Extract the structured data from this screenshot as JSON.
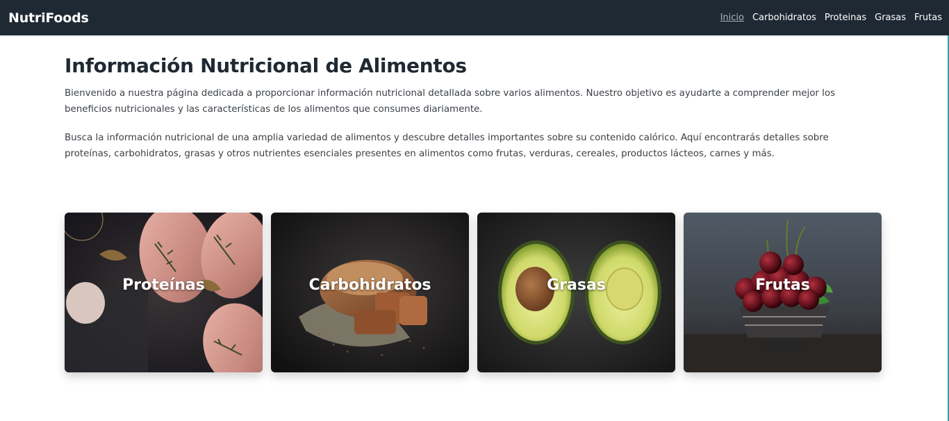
{
  "navbar": {
    "brand": "NutriFoods",
    "links": [
      "Inicio",
      "Carbohidratos",
      "Proteinas",
      "Grasas",
      "Frutas"
    ]
  },
  "main": {
    "title": "Información Nutricional de Alimentos",
    "paragraphs": [
      "Bienvenido a nuestra página dedicada a proporcionar información nutricional detallada sobre varios alimentos. Nuestro objetivo es ayudarte a comprender mejor los beneficios nutricionales y las características de los alimentos que consumes diariamente.",
      "Busca la información nutricional de una amplia variedad de alimentos y descubre detalles importantes sobre su contenido calórico. Aquí encontrarás detalles sobre proteínas, carbohidratos, grasas y otros nutrientes esenciales presentes en alimentos como frutas, verduras, cereales, productos lácteos, carnes y más."
    ]
  },
  "cards": [
    {
      "label": "Proteínas",
      "image": "raw-chicken-breast-photo"
    },
    {
      "label": "Carbohidratos",
      "image": "bread-loaf-photo"
    },
    {
      "label": "Grasas",
      "image": "avocado-halves-photo"
    },
    {
      "label": "Frutas",
      "image": "cherries-bowl-photo"
    }
  ],
  "colors": {
    "navbar_bg": "#1f2933",
    "title": "#1f2933",
    "accent_edge": "#3aa2a8"
  }
}
